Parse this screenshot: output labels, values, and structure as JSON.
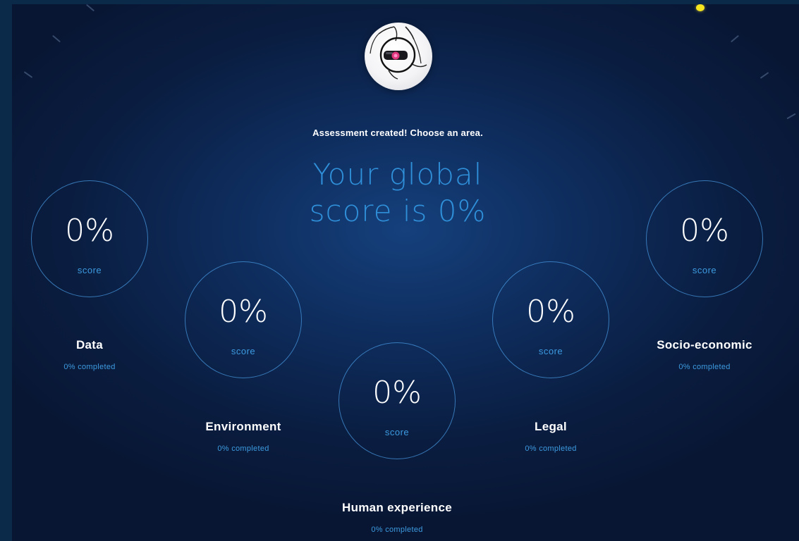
{
  "header": {
    "subtitle": "Assessment created! Choose an area.",
    "global_score_line1": "Your global",
    "global_score_line2": "score is 0%"
  },
  "areas": [
    {
      "name": "Data",
      "score": "0%",
      "score_label": "score",
      "completed": "0% completed"
    },
    {
      "name": "Environment",
      "score": "0%",
      "score_label": "score",
      "completed": "0% completed"
    },
    {
      "name": "Human experience",
      "score": "0%",
      "score_label": "score",
      "completed": "0% completed"
    },
    {
      "name": "Legal",
      "score": "0%",
      "score_label": "score",
      "completed": "0% completed"
    },
    {
      "name": "Socio-economic",
      "score": "0%",
      "score_label": "score",
      "completed": "0% completed"
    }
  ],
  "colors": {
    "accent": "#2f8fd8",
    "circle_border": "#4696dc",
    "background": "#0e2c5c",
    "indicator_dot": "#f5e51f"
  },
  "icons": {
    "avatar": "robot-eye-avatar-icon",
    "indicator": "yellow-dot-icon"
  }
}
